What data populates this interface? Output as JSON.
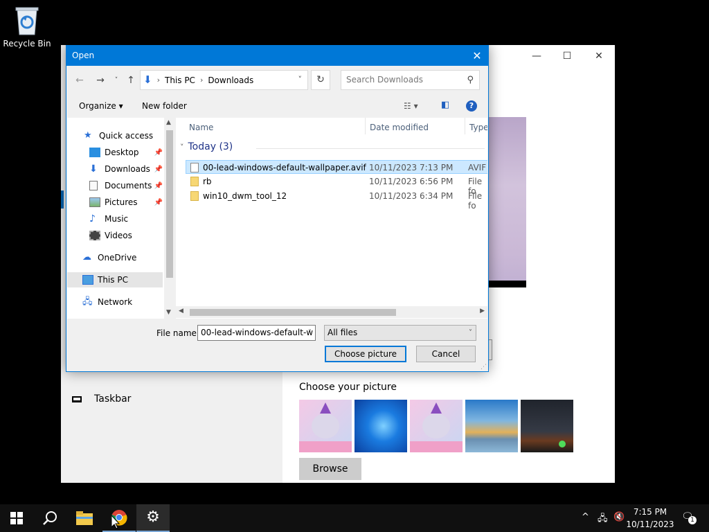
{
  "desktop": {
    "recycle_bin_label": "Recycle Bin"
  },
  "settings_window": {
    "taskbar_label": "Taskbar",
    "choose_picture_title": "Choose your picture",
    "browse_label": "Browse",
    "minimize": "—",
    "maximize": "☐",
    "close": "✕"
  },
  "dialog": {
    "title": "Open",
    "close": "✕",
    "address": {
      "root": "This PC",
      "folder": "Downloads"
    },
    "search_placeholder": "Search Downloads",
    "toolbar": {
      "organize": "Organize ▾",
      "new_folder": "New folder",
      "help": "?"
    },
    "nav": {
      "quick_access": "Quick access",
      "desktop": "Desktop",
      "downloads": "Downloads",
      "documents": "Documents",
      "pictures": "Pictures",
      "music": "Music",
      "videos": "Videos",
      "onedrive": "OneDrive",
      "this_pc": "This PC",
      "network": "Network"
    },
    "columns": {
      "name": "Name",
      "date": "Date modified",
      "type": "Type"
    },
    "group": "Today (3)",
    "files": [
      {
        "name": "00-lead-windows-default-wallpaper.avif",
        "date": "10/11/2023 7:13 PM",
        "type": "AVIF"
      },
      {
        "name": "rb",
        "date": "10/11/2023 6:56 PM",
        "type": "File fo"
      },
      {
        "name": "win10_dwm_tool_12",
        "date": "10/11/2023 6:34 PM",
        "type": "File fo"
      }
    ],
    "file_name_label": "File name:",
    "file_name_value": "00-lead-windows-default-w",
    "filter_value": "All files",
    "choose_button": "Choose picture",
    "cancel_button": "Cancel"
  },
  "taskbar": {
    "time": "7:15 PM",
    "date": "10/11/2023",
    "notification_count": "1"
  },
  "colors": {
    "accent": "#0078d7",
    "selection": "#cce8ff"
  }
}
